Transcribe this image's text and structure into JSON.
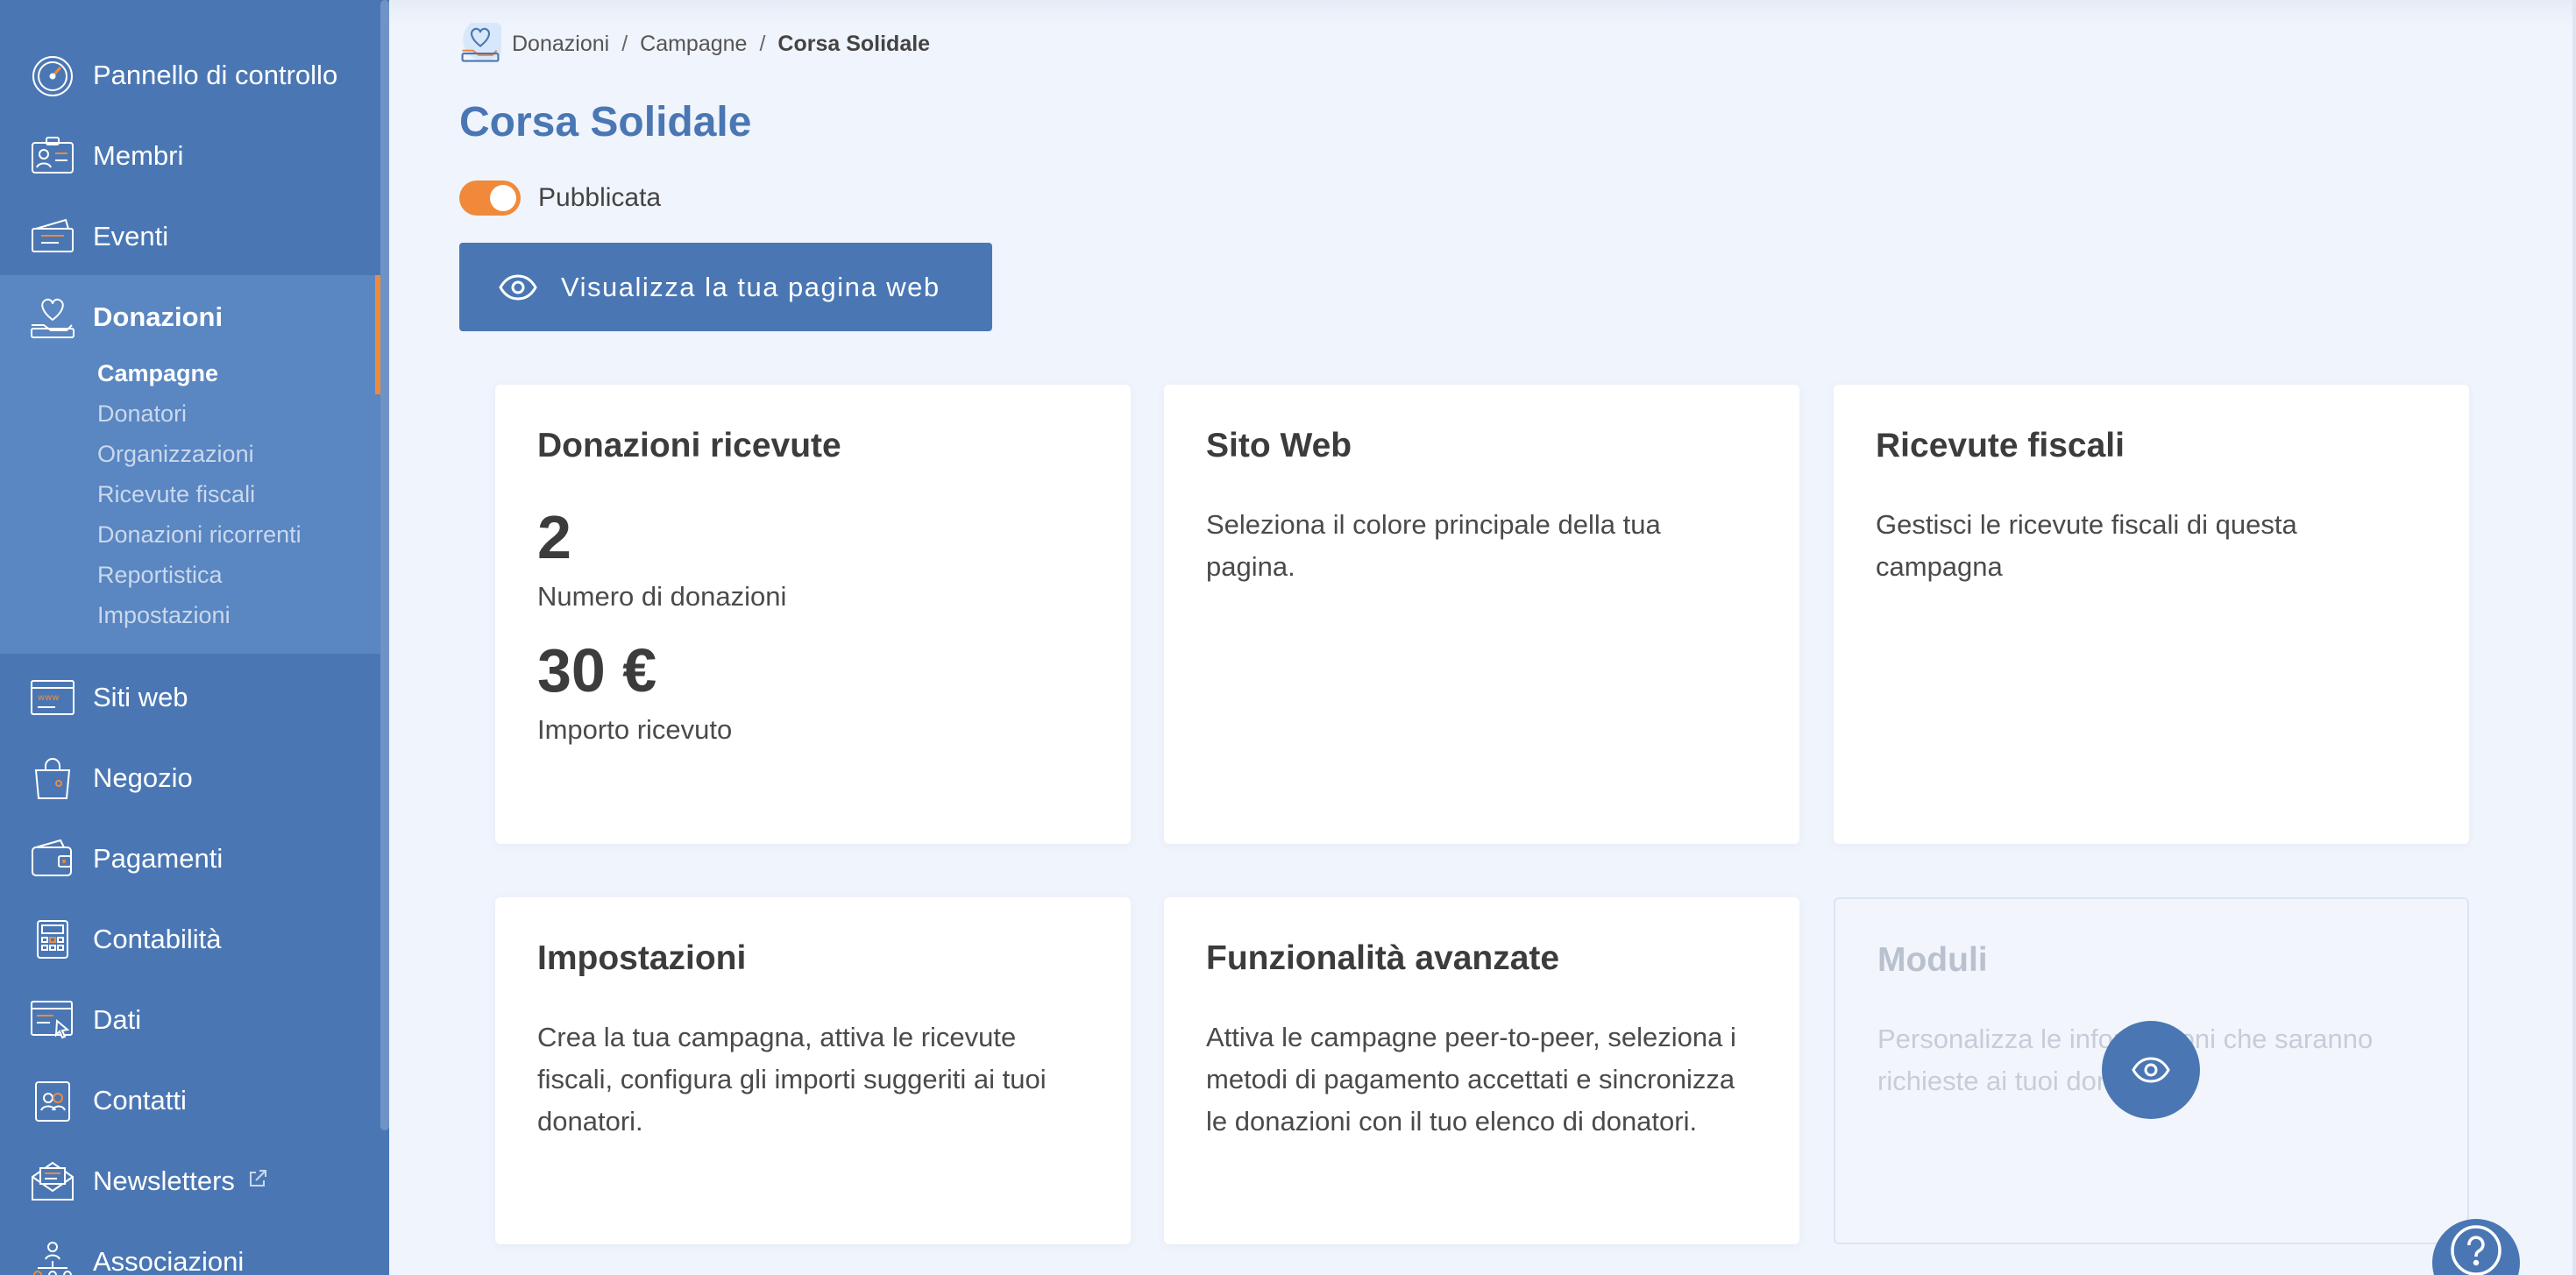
{
  "sidebar": {
    "items": [
      {
        "label": "Pannello di controllo",
        "icon": "dashboard-gauge-icon"
      },
      {
        "label": "Membri",
        "icon": "member-card-icon"
      },
      {
        "label": "Eventi",
        "icon": "ticket-icon"
      },
      {
        "label": "Donazioni",
        "icon": "heart-hand-icon"
      },
      {
        "label": "Siti web",
        "icon": "website-icon"
      },
      {
        "label": "Negozio",
        "icon": "shopping-bag-icon"
      },
      {
        "label": "Pagamenti",
        "icon": "wallet-icon"
      },
      {
        "label": "Contabilità",
        "icon": "calculator-icon"
      },
      {
        "label": "Dati",
        "icon": "data-window-icon"
      },
      {
        "label": "Contatti",
        "icon": "contacts-icon"
      },
      {
        "label": "Newsletters",
        "icon": "newsletter-envelope-icon"
      },
      {
        "label": "Associazioni",
        "icon": "associations-icon"
      }
    ],
    "sub_items": [
      "Campagne",
      "Donatori",
      "Organizzazioni",
      "Ricevute fiscali",
      "Donazioni ricorrenti",
      "Reportistica",
      "Impostazioni"
    ],
    "active_item": "Donazioni",
    "active_sub_item": "Campagne"
  },
  "breadcrumb": {
    "items": [
      "Donazioni",
      "Campagne",
      "Corsa Solidale"
    ],
    "separator": "/"
  },
  "page": {
    "title": "Corsa Solidale",
    "publish_label": "Pubblicata",
    "published": true,
    "view_button_label": "Visualizza la tua pagina web"
  },
  "cards": {
    "donations": {
      "title": "Donazioni ricevute",
      "count_value": "2",
      "count_label": "Numero di donazioni",
      "amount_value": "30 €",
      "amount_label": "Importo ricevuto"
    },
    "website": {
      "title": "Sito Web",
      "text": "Seleziona il colore principale della tua pagina."
    },
    "receipts": {
      "title": "Ricevute fiscali",
      "text": "Gestisci le ricevute fiscali di questa campagna"
    },
    "settings": {
      "title": "Impostazioni",
      "text": "Crea la tua campagna, attiva le ricevute fiscali, configura gli importi suggeriti ai tuoi donatori."
    },
    "advanced": {
      "title": "Funzionalità avanzate",
      "text": "Attiva le campagne peer-to-peer, seleziona i metodi di pagamento accettati e sincronizza le donazioni con il tuo elenco di donatori."
    },
    "modules": {
      "title": "Moduli",
      "text": "Personalizza le informazioni che saranno richieste ai tuoi donatori"
    }
  },
  "colors": {
    "sidebar": "#4a77b4",
    "sidebar_active": "#5a86c1",
    "accent": "#f08a3a",
    "primary": "#4a77b4",
    "background": "#f0f4fc"
  }
}
